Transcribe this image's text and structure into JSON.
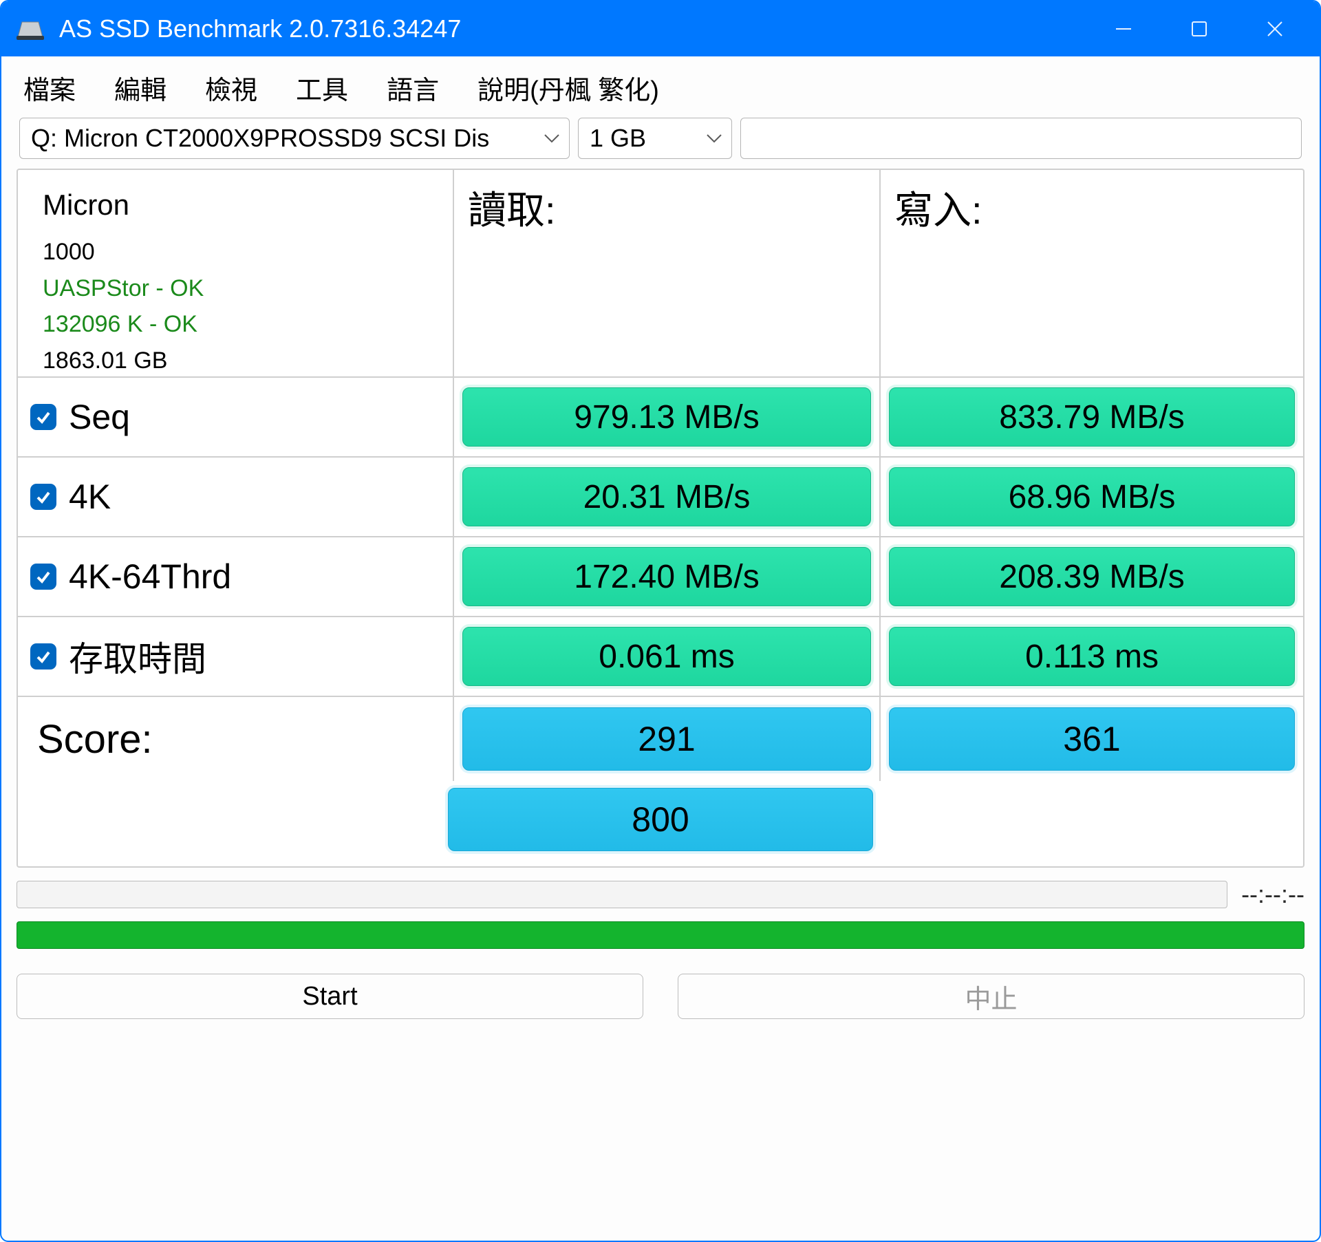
{
  "window": {
    "title": "AS SSD Benchmark 2.0.7316.34247"
  },
  "menu": {
    "file": "檔案",
    "edit": "編輯",
    "view": "檢視",
    "tools": "工具",
    "lang": "語言",
    "help": "說明(丹楓 繁化)"
  },
  "selectors": {
    "drive": "Q: Micron CT2000X9PROSSD9 SCSI Dis",
    "size": "1 GB"
  },
  "info": {
    "mfr": "Micron",
    "model": "1000",
    "driver": "UASPStor - OK",
    "align": "132096 K - OK",
    "capacity": "1863.01 GB"
  },
  "headers": {
    "read": "讀取:",
    "write": "寫入:"
  },
  "rows": [
    {
      "label": "Seq",
      "read": "979.13 MB/s",
      "write": "833.79 MB/s"
    },
    {
      "label": "4K",
      "read": "20.31 MB/s",
      "write": "68.96 MB/s"
    },
    {
      "label": "4K-64Thrd",
      "read": "172.40 MB/s",
      "write": "208.39 MB/s"
    },
    {
      "label": "存取時間",
      "read": "0.061 ms",
      "write": "0.113 ms"
    }
  ],
  "score": {
    "label": "Score:",
    "read": "291",
    "write": "361",
    "total": "800"
  },
  "timer": "--:--:--",
  "buttons": {
    "start": "Start",
    "abort": "中止"
  }
}
